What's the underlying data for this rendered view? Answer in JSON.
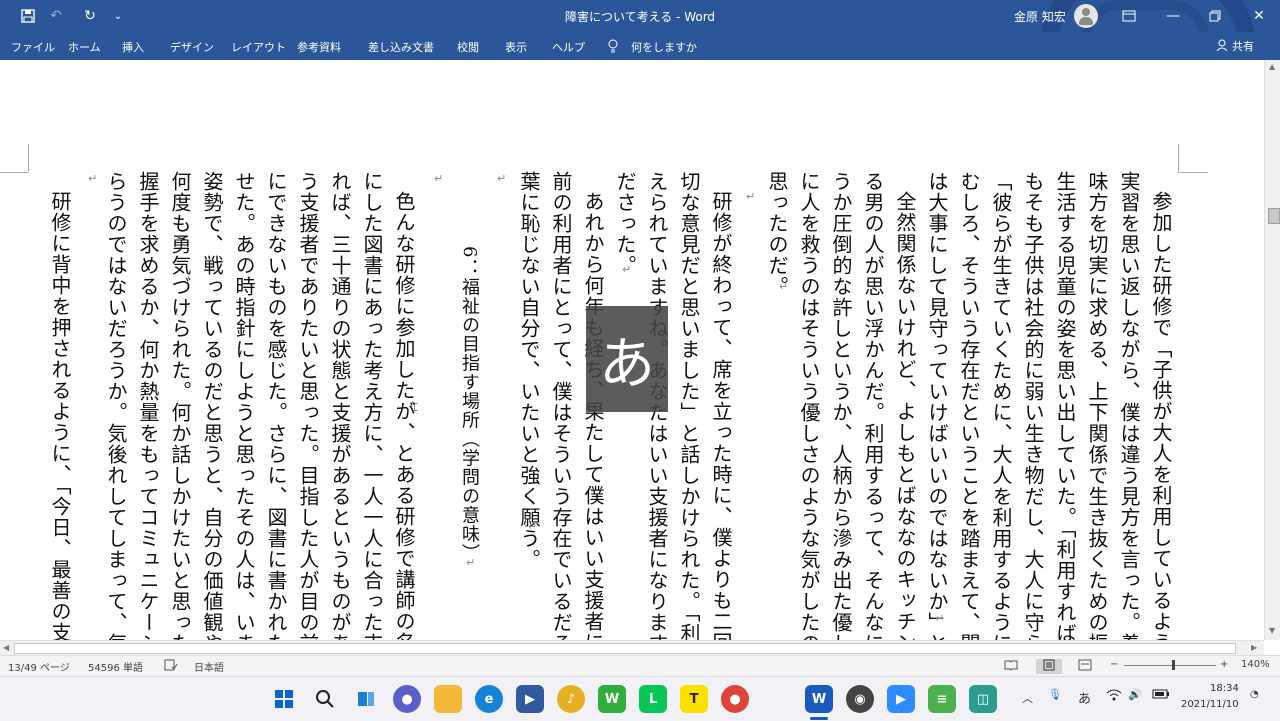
{
  "titlebar": {
    "doc_title": "障害について考える - Word",
    "user_name": "金原 知宏",
    "qat": {
      "save_icon": "save-icon",
      "undo_icon": "undo-icon",
      "redo_icon": "redo-icon",
      "customize_icon": "chevron-down-icon"
    },
    "window": {
      "ribbon_display": "ribbon-display-icon",
      "minimize": "minimize-icon",
      "maximize": "maximize-icon",
      "close": "close-icon"
    }
  },
  "ribbon": {
    "tabs": [
      "ファイル",
      "ホーム",
      "挿入",
      "デザイン",
      "レイアウト",
      "参考資料",
      "差し込み文書",
      "校閲",
      "表示",
      "ヘルプ"
    ],
    "tell_me": "何をしますか",
    "share": "共有"
  },
  "document": {
    "columns": [
      "参加した研修で「子供が大人を利用しているように見え",
      "実習を思い返しながら、僕は違う見方を言った。養護施設",
      "味方を切実に求める、上下関係で生き抜くための振る舞い",
      "生活する児童の姿を思い出していた。「利用すればいいん",
      "もそも子供は社会的に弱い生き物だし、大人に守られなけ",
      "「彼らが生きていくために、大人を利用するように見えて",
      "むしろ、そういう存在だということを踏まえて、関わって",
      "は大事にして見守っていけばいいのではないか」と。",
      "全然関係ないけれど、よしもとばななのキッチンで「利",
      "る男の人が思い浮かんだ。利用するって、そんなに悪いこ",
      "うか圧倒的な許しというか、人柄から滲み出た優しさによ",
      "に人を救うのはそういう優しさのような気がしたのだ。福",
      "思ったのだ。",
      "研修が終わって、席を立った時に、僕よりも二回りくら",
      "切な意見だと思いました」と話しかけられた。「利用して",
      "えられていますね。あなたはいい支援者になります",
      "ださった。",
      "あれから何年も経ち、果たして僕はいい支援者になれた",
      "前の利用者にとって、僕はそういう存在でいるだろうか、",
      "葉に恥じない自分で、いたいと強く願う。",
      "6：福祉の目指す場所（学問の意味）",
      "色んな研修に参加したが、とある研修で講師の名前に心",
      "にした図書にあった考え方に、一人一人に合った支援をす",
      "れば、三十通りの状態と支援があるというものがあった。",
      "う支援者でありたいと思った。目指した人が目の前で教",
      "にできないものを感じた。さらに、図書に書かれた言葉と",
      "せた。あの時指針にしようと思ったその人は、いまだに福",
      "姿勢で、戦っているのだと思うと、自分の価値観や大切に",
      "何度も勇気づけられた。何か話しかけたいと思ったが、面",
      "握手を求めるか、何か熱量をもってコミュニケーションを",
      "らうのではないだろうか。気後れしてしまって、毎回、声",
      "研修に背中を押されるように、「今日、最善の支援をし"
    ],
    "ime_mode": "あ"
  },
  "statusbar": {
    "page": "13/49 ページ",
    "words": "54596 単語",
    "language": "日本語",
    "zoom": "140%"
  },
  "taskbar": {
    "time": "18:34",
    "date": "2021/11/10",
    "ime": "あ"
  }
}
